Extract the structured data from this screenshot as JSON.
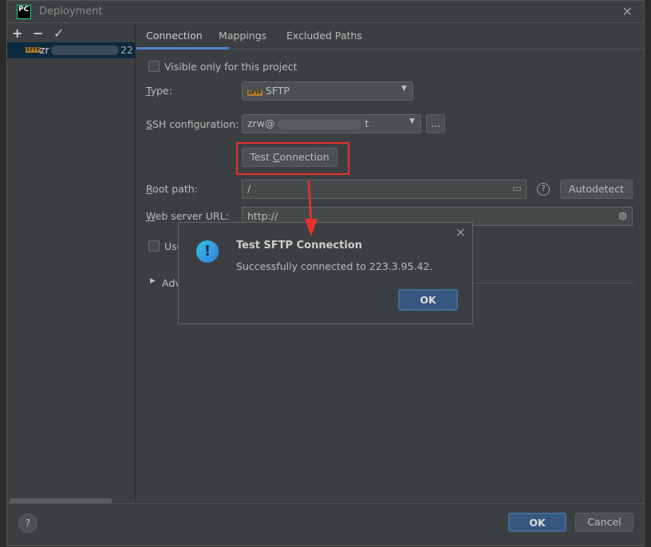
{
  "window": {
    "title": "Deployment",
    "logo": "PC",
    "close_icon": "close-icon"
  },
  "sidebar": {
    "tools": [
      "+",
      "−",
      "✓"
    ],
    "item": {
      "badge": "SFTP",
      "label_start": "zr",
      "label_end": "22"
    }
  },
  "tabs": [
    {
      "label": "Connection",
      "active": true
    },
    {
      "label": "Mappings"
    },
    {
      "label": "Excluded Paths"
    }
  ],
  "form": {
    "visible_only": {
      "label": "Visible only for this project",
      "checked": false
    },
    "type": {
      "label_u": "T",
      "label_rest": "ype:",
      "value": "SFTP",
      "badge": "SFTP"
    },
    "ssh": {
      "label_u": "S",
      "label_rest": "SH configuration:",
      "value_start": "zrw@",
      "value_end": "t",
      "more": "..."
    },
    "test_button": {
      "pre": "Test ",
      "u": "C",
      "post": "onnection"
    },
    "root_path": {
      "label_u": "R",
      "label_rest": "oot path:",
      "value": "/",
      "help": "?",
      "autodetect": "Autodetect"
    },
    "web_url": {
      "label_u": "W",
      "label_rest": "eb server URL:",
      "value": "http://"
    },
    "use_checkbox": "Use",
    "advanced": "Adv"
  },
  "dialog": {
    "title": "Test SFTP Connection",
    "message": "Successfully connected to 223.3.95.42.",
    "ok": "OK",
    "close": "×"
  },
  "footer": {
    "help": "?",
    "ok": "OK",
    "cancel": "Cancel"
  },
  "colors": {
    "accent": "#4a88c7",
    "annotation": "#e8312f",
    "ok_button": "#365880"
  }
}
